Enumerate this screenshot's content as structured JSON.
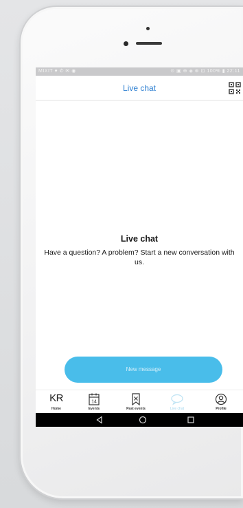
{
  "status_bar": {
    "left_text": "MIXIT ♥ ✆ ✉ ◉",
    "right_text": "⊙ ▣ ⊕ ◈ ⊛ ⊡ 100% ▮ 22:11"
  },
  "app_bar": {
    "title": "Live chat",
    "qr_icon": "qr-code-icon"
  },
  "empty_state": {
    "title": "Live chat",
    "description": "Have a question? A problem? Start a new conversation with us."
  },
  "primary_action": {
    "label": "New message"
  },
  "tab_bar": {
    "items": [
      {
        "id": "home",
        "label": "Home",
        "logo_text": "KR",
        "icon": "kr-logo-icon",
        "active": false
      },
      {
        "id": "events",
        "label": "Events",
        "icon": "calendar-icon",
        "active": false
      },
      {
        "id": "past-events",
        "label": "Past events",
        "icon": "bookmark-icon",
        "active": false
      },
      {
        "id": "live-chat",
        "label": "Live chat",
        "icon": "chat-icon",
        "active": true
      },
      {
        "id": "profile",
        "label": "Profile",
        "icon": "profile-icon",
        "active": false
      }
    ]
  },
  "system_nav": {
    "back_icon": "back-triangle-icon",
    "home_icon": "home-circle-icon",
    "recents_icon": "recents-square-icon"
  },
  "colors": {
    "title_blue": "#2d7fd1",
    "button_blue": "#49bdea",
    "nav_bar": "#000000",
    "active_tab": "#9fd6ee"
  }
}
